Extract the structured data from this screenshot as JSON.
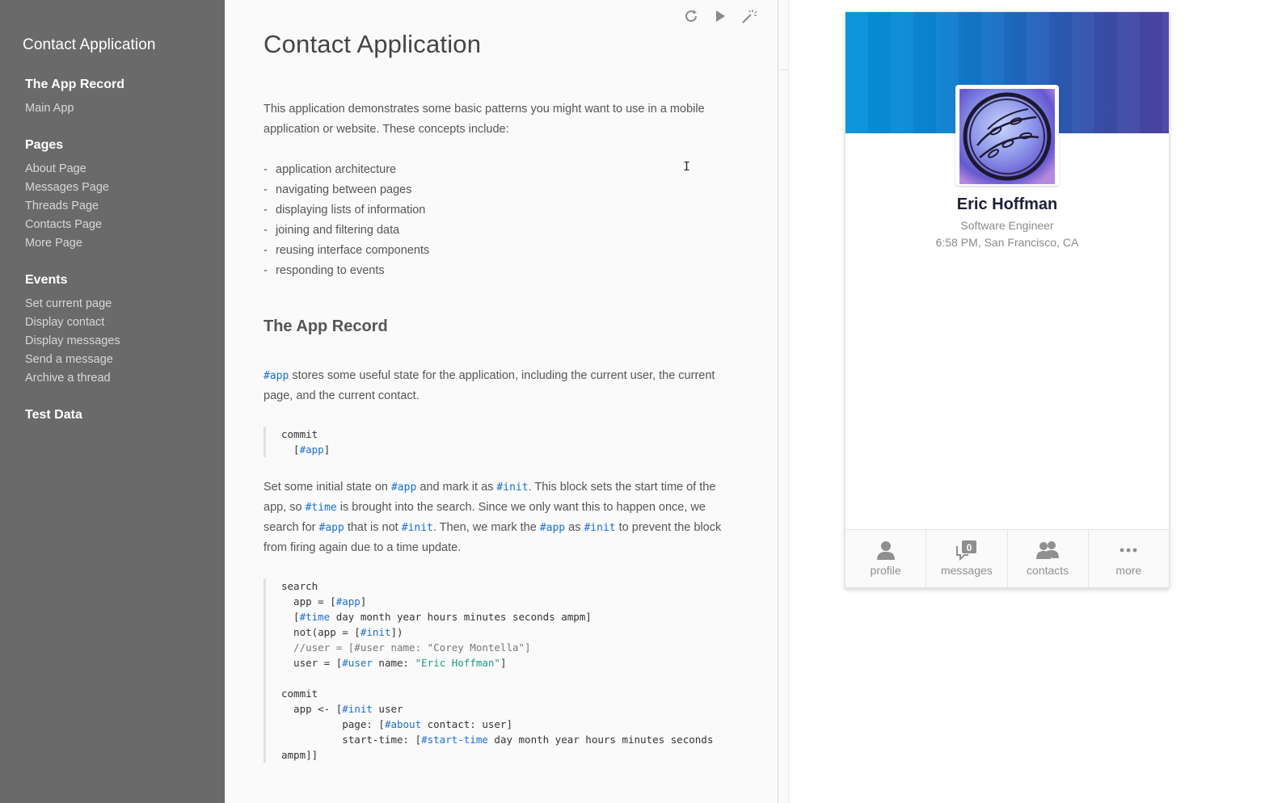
{
  "sidebar": {
    "app_title": "Contact Application",
    "sections": [
      {
        "title": "The App Record",
        "items": [
          "Main App"
        ]
      },
      {
        "title": "Pages",
        "items": [
          "About Page",
          "Messages Page",
          "Threads Page",
          "Contacts Page",
          "More Page"
        ]
      },
      {
        "title": "Events",
        "items": [
          "Set current page",
          "Display contact",
          "Display messages",
          "Send a message",
          "Archive a thread"
        ]
      },
      {
        "title": "Test Data",
        "items": []
      }
    ]
  },
  "toolbar": {
    "icons": [
      "refresh-icon",
      "play-icon",
      "magic-wand-icon"
    ]
  },
  "doc": {
    "title": "Contact Application",
    "intro": "This application demonstrates some basic patterns you might want to use in a mobile application or website. These concepts include:",
    "concepts": [
      "application architecture",
      "navigating between pages",
      "displaying lists of information",
      "joining and filtering data",
      "reusing interface components",
      "responding to events"
    ],
    "section_title": "The App Record",
    "app_para": {
      "tag": "#app",
      "rest": " stores some useful state for the application, including the current user, the current page, and the current contact."
    },
    "init_para": {
      "p1": "Set some initial state on ",
      "tag_app": "#app",
      "p2": " and mark it as ",
      "tag_init": "#init",
      "p3": ". This block sets the start time of the app, so ",
      "tag_time": "#time",
      "p4": " is brought into the search. Since we only want this to happen once, we search for ",
      "p5": " that is not ",
      "p6": ". Then, we mark the ",
      "p7": " as ",
      "p8": " to prevent the block from firing again due to a time update."
    },
    "code1": {
      "l1": "commit",
      "l2_pre": "  [",
      "l2_tag": "#app",
      "l2_post": "]"
    },
    "code2": {
      "search": "search",
      "a_pre": "  app = [",
      "a_tag": "#app",
      "a_post": "]",
      "t_pre": "  [",
      "t_tag": "#time",
      "t_post": " day month year hours minutes seconds ampm]",
      "n_pre": "  not(app = [",
      "n_tag": "#init",
      "n_post": "])",
      "comment": "  //user = [#user name: \"Corey Montella\"]",
      "u_pre": "  user = [",
      "u_tag": "#user",
      "u_mid": " name: ",
      "u_str": "\"Eric Hoffman\"",
      "u_post": "]",
      "commit": "commit",
      "c1_pre": "  app <- [",
      "c1_tag": "#init",
      "c1_post": " user",
      "c2_pre": "          page: [",
      "c2_tag": "#about",
      "c2_post": " contact: user]",
      "c3_pre": "          start-time: [",
      "c3_tag": "#start-time",
      "c3_post": " day month year hours minutes seconds",
      "c4": "ampm]]"
    },
    "cursor_glyph": "I"
  },
  "preview": {
    "name": "Eric Hoffman",
    "role": "Software Engineer",
    "location": "6:58 PM, San Francisco, CA",
    "tabs": [
      {
        "label": "profile",
        "icon": "person-icon"
      },
      {
        "label": "messages",
        "icon": "messages-icon",
        "badge": "0"
      },
      {
        "label": "contacts",
        "icon": "contacts-icon"
      },
      {
        "label": "more",
        "icon": "more-icon"
      }
    ],
    "colors": {
      "banner_start": "#0693da",
      "banner_end": "#4d43a3"
    }
  }
}
